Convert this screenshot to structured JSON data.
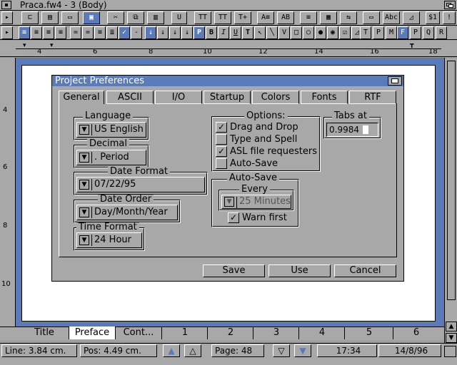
{
  "window": {
    "title": "Praca.fw4 - 3 (Body)"
  },
  "toolbar_row1": [
    "open",
    "save",
    "print",
    "screen",
    "cut",
    "copy",
    "paste",
    "U",
    "TT",
    "TT",
    "T+",
    "ruler-a",
    "ab",
    "justify",
    "grid",
    "link",
    "frame",
    "ABC",
    "graph",
    "$1",
    "!"
  ],
  "toolbar_row2": [
    "play",
    "align-left",
    "align-center",
    "align-right",
    "align-justify",
    "lines-1",
    "lines-2",
    "lines-3",
    "check",
    "down",
    "down",
    "down",
    "down",
    "P",
    "B",
    "I",
    "U",
    "T",
    "arrow",
    "line",
    "V",
    "rect",
    "circle",
    "radio",
    "target",
    "check",
    "triangle",
    "T",
    "P",
    "M",
    "F",
    "P"
  ],
  "ruler": {
    "marks": [
      "4",
      "6",
      "8",
      "10",
      "12",
      "14",
      "16",
      "18"
    ]
  },
  "vruler": {
    "marks": [
      "4",
      "6",
      "8",
      "10"
    ]
  },
  "dialog": {
    "title": "Project Preferences",
    "tabs": [
      "General",
      "ASCII",
      "I/O",
      "Startup",
      "Colors",
      "Fonts",
      "RTF"
    ],
    "language": {
      "label": "Language",
      "value": "US English"
    },
    "decimal": {
      "label": "Decimal",
      "value": ". Period"
    },
    "date_format": {
      "label": "Date Format",
      "value": "07/22/95"
    },
    "date_order": {
      "label": "Date Order",
      "value": "Day/Month/Year"
    },
    "time_format": {
      "label": "Time Format",
      "value": "24 Hour"
    },
    "options": {
      "label": "Options:",
      "items": [
        {
          "label": "Drag and Drop",
          "checked": true
        },
        {
          "label": "Type and Spell",
          "checked": false
        },
        {
          "label": "ASL file requesters",
          "checked": true
        },
        {
          "label": "Auto-Save",
          "checked": false
        }
      ]
    },
    "tabs_at": {
      "label": "Tabs at",
      "value": "0.9984"
    },
    "autosave": {
      "label": "Auto-Save",
      "every_label": "Every",
      "every_value": "25 Minutes",
      "warn_label": "Warn first",
      "warn_checked": true
    },
    "buttons": {
      "save": "Save",
      "use": "Use",
      "cancel": "Cancel"
    }
  },
  "doc_tabs": [
    "Title",
    "Preface",
    "Cont...",
    "1",
    "2",
    "3",
    "4",
    "5",
    "6"
  ],
  "status": {
    "line": "Line: 3.84 cm.",
    "pos": "Pos: 4.49 cm.",
    "page": "Page: 48",
    "time": "17:34",
    "date": "14/8/96"
  },
  "colors": {
    "accent": "#5a7ab8",
    "face": "#a8a8a8",
    "document": "#ffffff"
  }
}
